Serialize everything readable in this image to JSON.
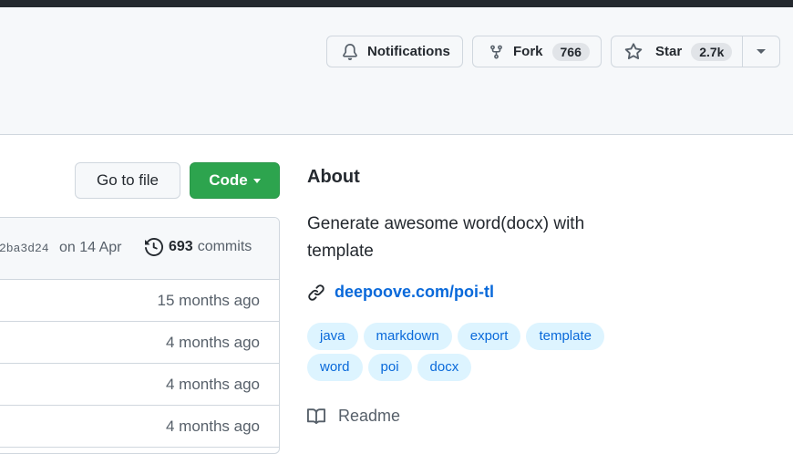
{
  "header": {
    "notifications_label": "Notifications",
    "fork_label": "Fork",
    "fork_count": "766",
    "star_label": "Star",
    "star_count": "2.7k"
  },
  "toolbar": {
    "go_to_file_label": "Go to file",
    "code_label": "Code"
  },
  "commit_bar": {
    "sha": "2ba3d24",
    "date": "on 14 Apr",
    "commit_count": "693",
    "commits_label": "commits"
  },
  "files": [
    {
      "age": "15 months ago"
    },
    {
      "age": "4 months ago"
    },
    {
      "age": "4 months ago"
    },
    {
      "age": "4 months ago"
    }
  ],
  "about": {
    "title": "About",
    "description": "Generate awesome word(docx) with template",
    "link": "deepoove.com/poi-tl",
    "topics": [
      "java",
      "markdown",
      "export",
      "template",
      "word",
      "poi",
      "docx"
    ],
    "readme_label": "Readme"
  },
  "icons": {
    "notifications": "bell-icon",
    "fork": "repo-forked-icon",
    "star": "star-icon",
    "dropdown": "triangle-down-icon",
    "history": "history-icon",
    "link": "link-icon",
    "readme": "book-icon"
  },
  "colors": {
    "code_button": "#2da44e",
    "link": "#0969da",
    "topic_bg": "#ddf4ff",
    "topbar": "#24292f"
  }
}
